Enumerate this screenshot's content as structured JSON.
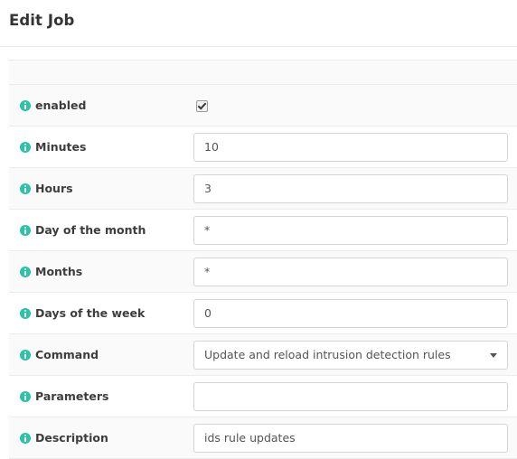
{
  "page": {
    "title": "Edit Job"
  },
  "table": {
    "header_row_empty": "",
    "rows": [
      {
        "icon": "info-icon",
        "label": "enabled",
        "control": "checkbox",
        "name": "enabled",
        "checked": true,
        "value": "",
        "placeholder": ""
      },
      {
        "icon": "info-icon",
        "label": "Minutes",
        "control": "text",
        "name": "minutes",
        "value": "10",
        "placeholder": ""
      },
      {
        "icon": "info-icon",
        "label": "Hours",
        "control": "text",
        "name": "hours",
        "value": "3",
        "placeholder": ""
      },
      {
        "icon": "info-icon",
        "label": "Day of the month",
        "control": "text",
        "name": "day-of-the-month",
        "value": "*",
        "placeholder": ""
      },
      {
        "icon": "info-icon",
        "label": "Months",
        "control": "text",
        "name": "months",
        "value": "*",
        "placeholder": ""
      },
      {
        "icon": "info-icon",
        "label": "Days of the week",
        "control": "text",
        "name": "days-of-the-week",
        "value": "0",
        "placeholder": ""
      },
      {
        "icon": "info-icon",
        "label": "Command",
        "control": "select",
        "name": "command",
        "value": "Update and reload intrusion detection rules",
        "caret": "chevron-down-icon",
        "placeholder": ""
      },
      {
        "icon": "info-icon",
        "label": "Parameters",
        "control": "text",
        "name": "parameters",
        "value": "",
        "placeholder": ""
      },
      {
        "icon": "info-icon",
        "label": "Description",
        "control": "text",
        "name": "description",
        "value": "ids rule updates",
        "placeholder": ""
      }
    ]
  },
  "colors": {
    "accent_teal": "#29c3a5",
    "row_alt_background": "#fafafa",
    "border": "#ececec",
    "input_border": "#d4d4d4",
    "label_text": "#3d3d3d",
    "value_text": "#555555"
  }
}
